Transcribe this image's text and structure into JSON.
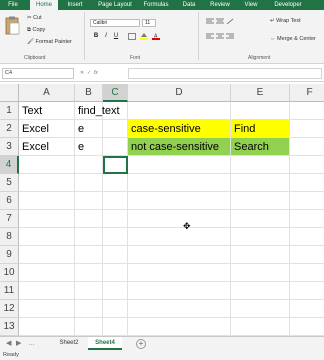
{
  "ribbon_tabs": [
    {
      "label": "File",
      "active": false
    },
    {
      "label": "Home",
      "active": true
    },
    {
      "label": "Insert",
      "active": false
    },
    {
      "label": "Page Layout",
      "active": false
    },
    {
      "label": "Formulas",
      "active": false
    },
    {
      "label": "Data",
      "active": false
    },
    {
      "label": "Review",
      "active": false
    },
    {
      "label": "View",
      "active": false
    },
    {
      "label": "Developer",
      "active": false
    }
  ],
  "clipboard": {
    "cut": "Cut",
    "copy": "Copy",
    "format_painter": "Format Painter",
    "group_label": "Clipboard"
  },
  "font": {
    "name": "Calibri",
    "size": "11",
    "group_label": "Font",
    "bold": "B",
    "italic": "I",
    "underline": "U"
  },
  "alignment": {
    "wrap_text": "Wrap Text",
    "merge_center": "Merge & Center",
    "group_label": "Alignment"
  },
  "name_box": {
    "value": "C4"
  },
  "columns": [
    "A",
    "B",
    "C",
    "D",
    "E",
    "F"
  ],
  "rows": [
    "1",
    "2",
    "3",
    "4",
    "5",
    "6",
    "7",
    "8",
    "9",
    "10",
    "11",
    "12",
    "13"
  ],
  "cells": {
    "A1": "Text",
    "B1": "find_text",
    "A2": "Excel",
    "B2": "e",
    "D2": "case-sensitive",
    "E2": "Find",
    "A3": "Excel",
    "B3": "e",
    "D3": "not case-sensitive",
    "E3": "Search"
  },
  "fill_colors": {
    "yellow": "#ffff00",
    "green": "#92d050",
    "accent": "#217346"
  },
  "sheets": [
    {
      "label": "Sheet2",
      "active": false
    },
    {
      "label": "Sheet4",
      "active": true
    }
  ],
  "status": {
    "text": "Ready"
  }
}
